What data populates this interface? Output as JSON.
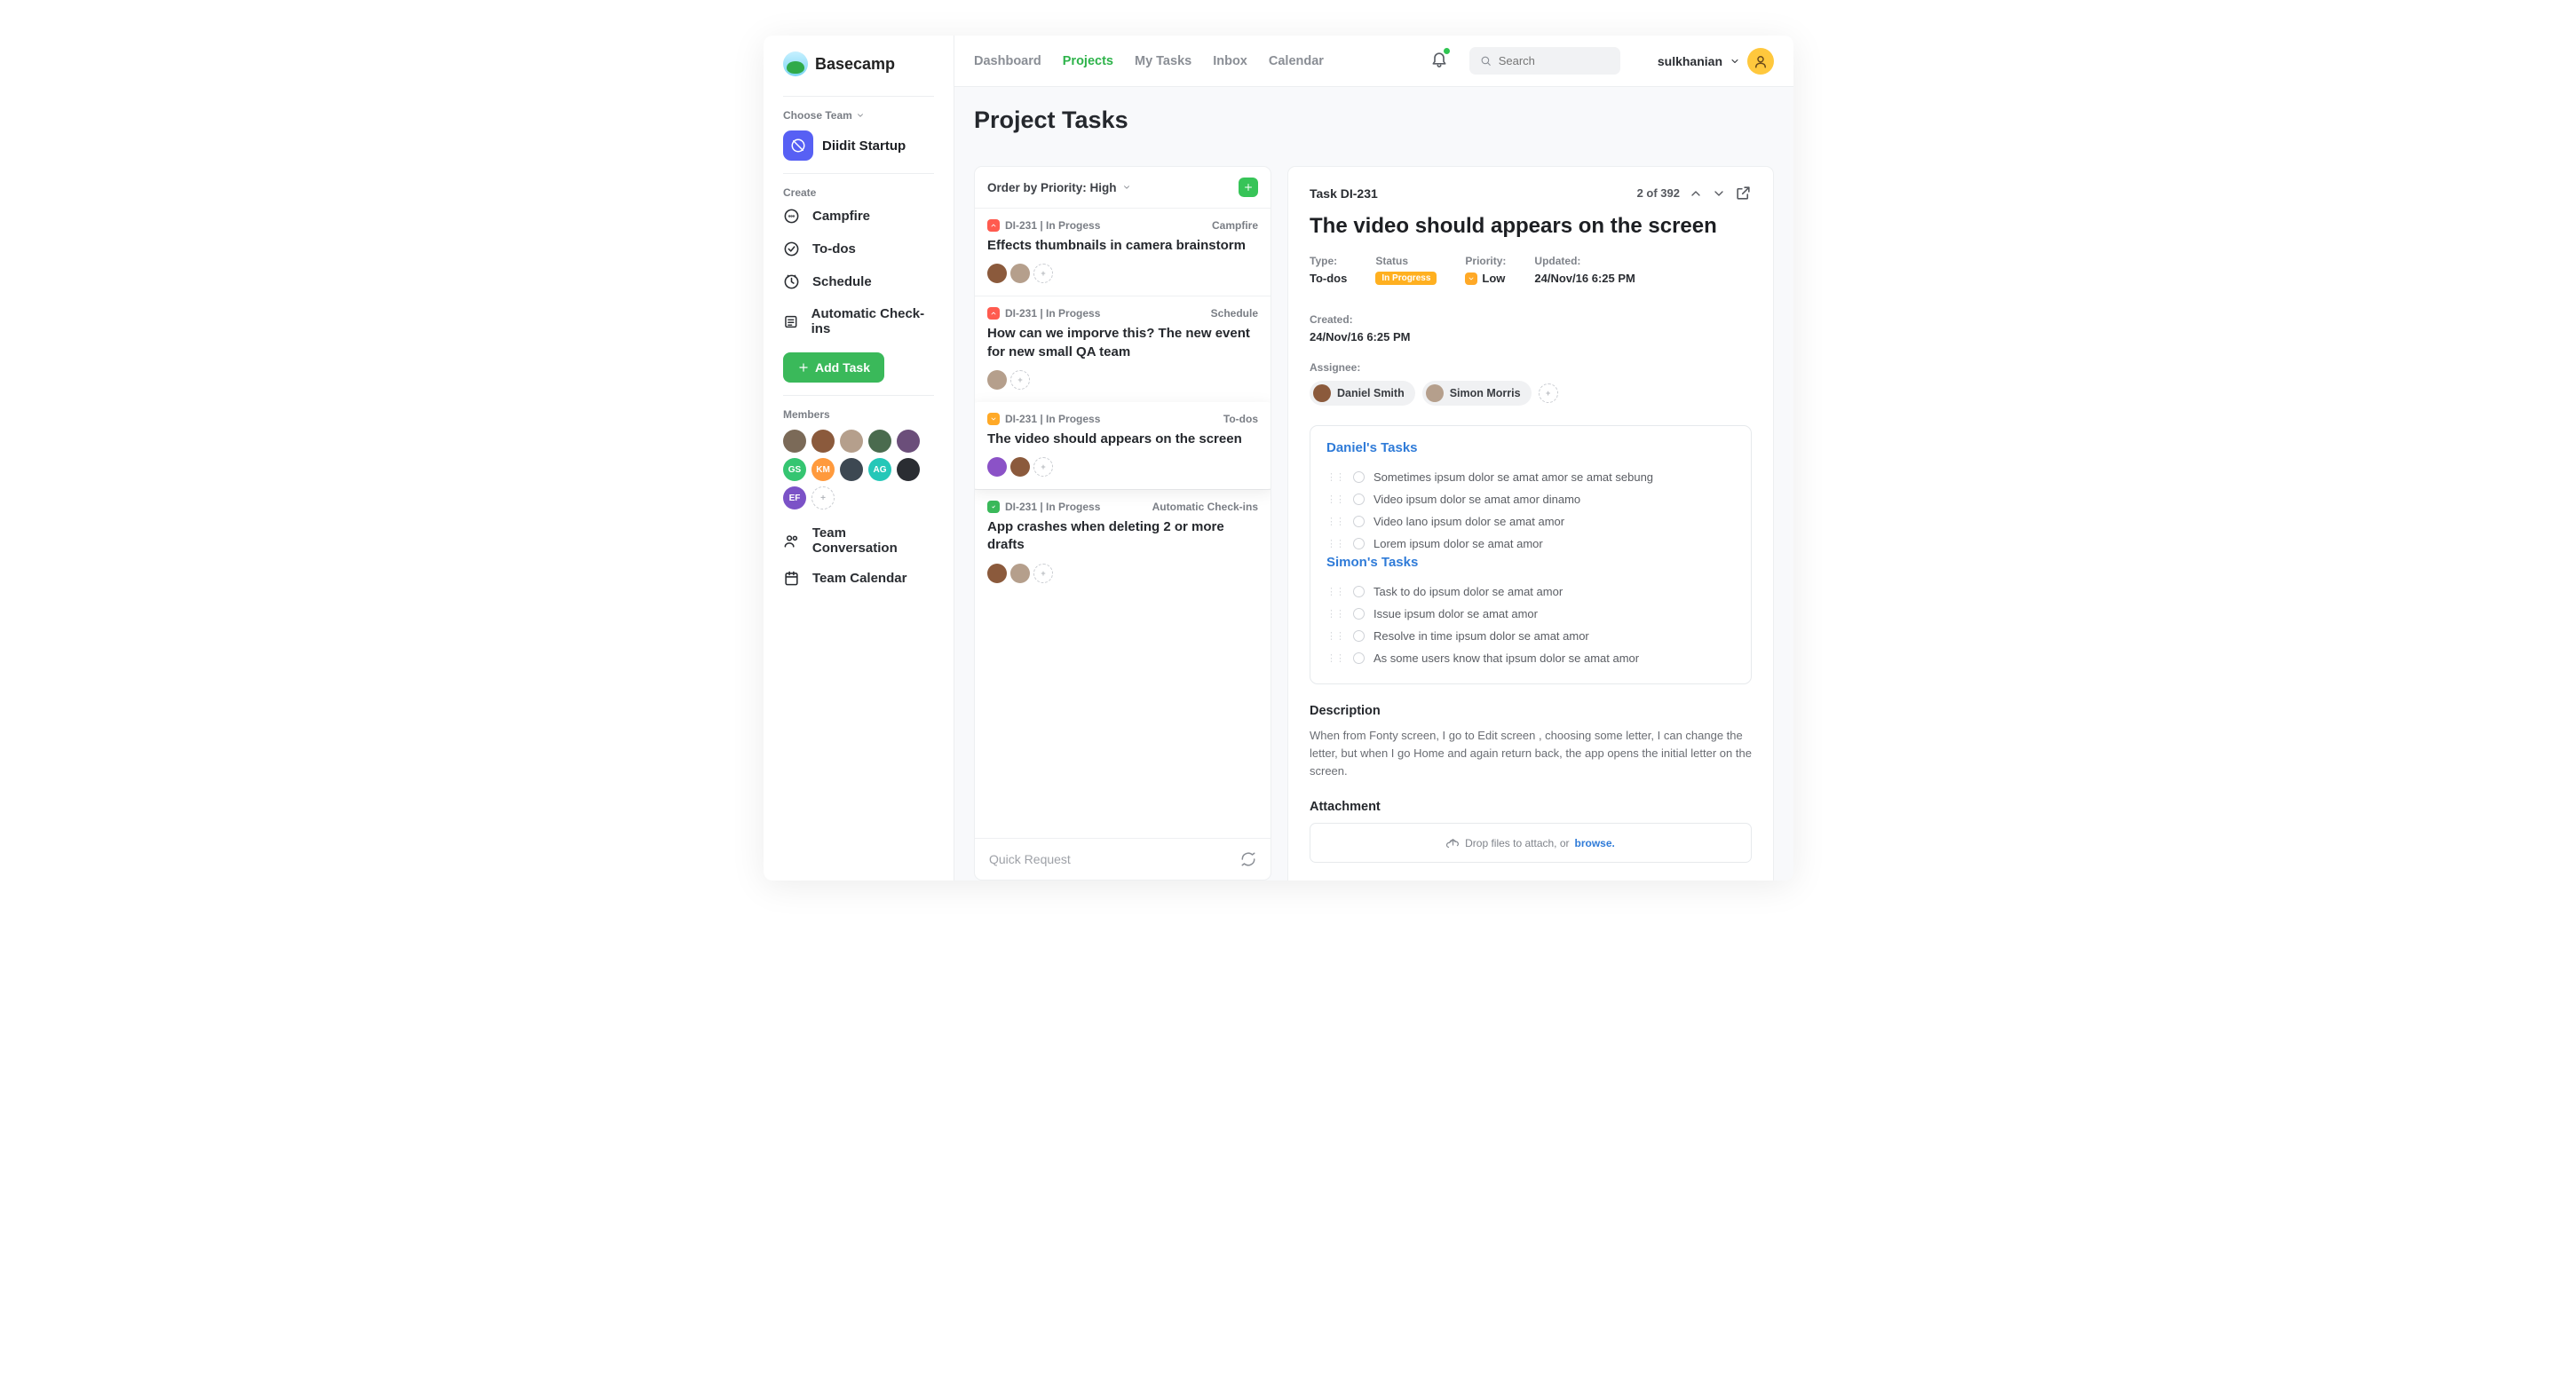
{
  "brand": "Basecamp",
  "team_picker_label": "Choose Team",
  "team": {
    "name": "Diidit Startup"
  },
  "create": {
    "label": "Create",
    "items": [
      {
        "key": "campfire",
        "label": "Campfire"
      },
      {
        "key": "todos",
        "label": "To-dos"
      },
      {
        "key": "schedule",
        "label": "Schedule"
      },
      {
        "key": "checkins",
        "label": "Automatic Check-ins"
      }
    ],
    "add_task": "Add Task"
  },
  "members": {
    "label": "Members",
    "chips": [
      "",
      "",
      "",
      "",
      "",
      "GS",
      "KM",
      "",
      "AG",
      "",
      "EF"
    ]
  },
  "team_links": {
    "conversation": "Team Conversation",
    "calendar": "Team Calendar"
  },
  "nav": {
    "dashboard": "Dashboard",
    "projects": "Projects",
    "my_tasks": "My Tasks",
    "inbox": "Inbox",
    "calendar": "Calendar"
  },
  "search": {
    "placeholder": "Search"
  },
  "user": {
    "name": "sulkhanian"
  },
  "page_title": "Project Tasks",
  "task_list": {
    "order_by": "Order by Priority: High",
    "quick_request": "Quick Request",
    "items": [
      {
        "priority": "red",
        "id": "DI-231",
        "status": "In Progess",
        "tag": "Campfire",
        "title": "Effects thumbnails in camera brainstorm",
        "avatars": 2
      },
      {
        "priority": "red",
        "id": "DI-231",
        "status": "In Progess",
        "tag": "Schedule",
        "title": "How can we imporve this? The new event for new small QA team",
        "avatars": 1
      },
      {
        "priority": "orange",
        "id": "DI-231",
        "status": "In Progess",
        "tag": "To-dos",
        "title": "The video should appears on the screen",
        "avatars": 2,
        "selected": true
      },
      {
        "priority": "green",
        "id": "DI-231",
        "status": "In Progess",
        "tag": "Automatic Check-ins",
        "title": "App crashes when deleting 2 or more drafts",
        "avatars": 2
      }
    ]
  },
  "detail": {
    "id_label": "Task DI-231",
    "pager": "2 of 392",
    "title": "The video should appears on the screen",
    "meta": {
      "type_label": "Type:",
      "type_value": "To-dos",
      "status_label": "Status",
      "status_value": "In Progress",
      "priority_label": "Priority:",
      "priority_value": "Low",
      "updated_label": "Updated:",
      "updated_value": "24/Nov/16 6:25 PM",
      "created_label": "Created:",
      "created_value": "24/Nov/16 6:25 PM"
    },
    "assignee_label": "Assignee:",
    "assignees": [
      {
        "name": "Daniel Smith"
      },
      {
        "name": "Simon Morris"
      }
    ],
    "sections": [
      {
        "title": "Daniel's Tasks",
        "items": [
          "Sometimes ipsum dolor se amat amor se amat sebung",
          "Video ipsum dolor se amat amor dinamo",
          "Video lano ipsum dolor se amat amor",
          "Lorem ipsum dolor se amat amor"
        ]
      },
      {
        "title": "Simon's Tasks",
        "items": [
          "Task to do ipsum dolor se amat amor",
          "Issue ipsum dolor se amat amor",
          "Resolve in time ipsum dolor se amat amor",
          "As some users know that ipsum dolor se amat amor"
        ]
      }
    ],
    "description_label": "Description",
    "description": "When from Fonty screen, I go to Edit screen , choosing some letter, I can change the letter, but when I go Home and again return back, the app opens the initial letter on the screen.",
    "attachment_label": "Attachment",
    "attachment_text": "Drop files to attach, or ",
    "attachment_link": "browse."
  }
}
